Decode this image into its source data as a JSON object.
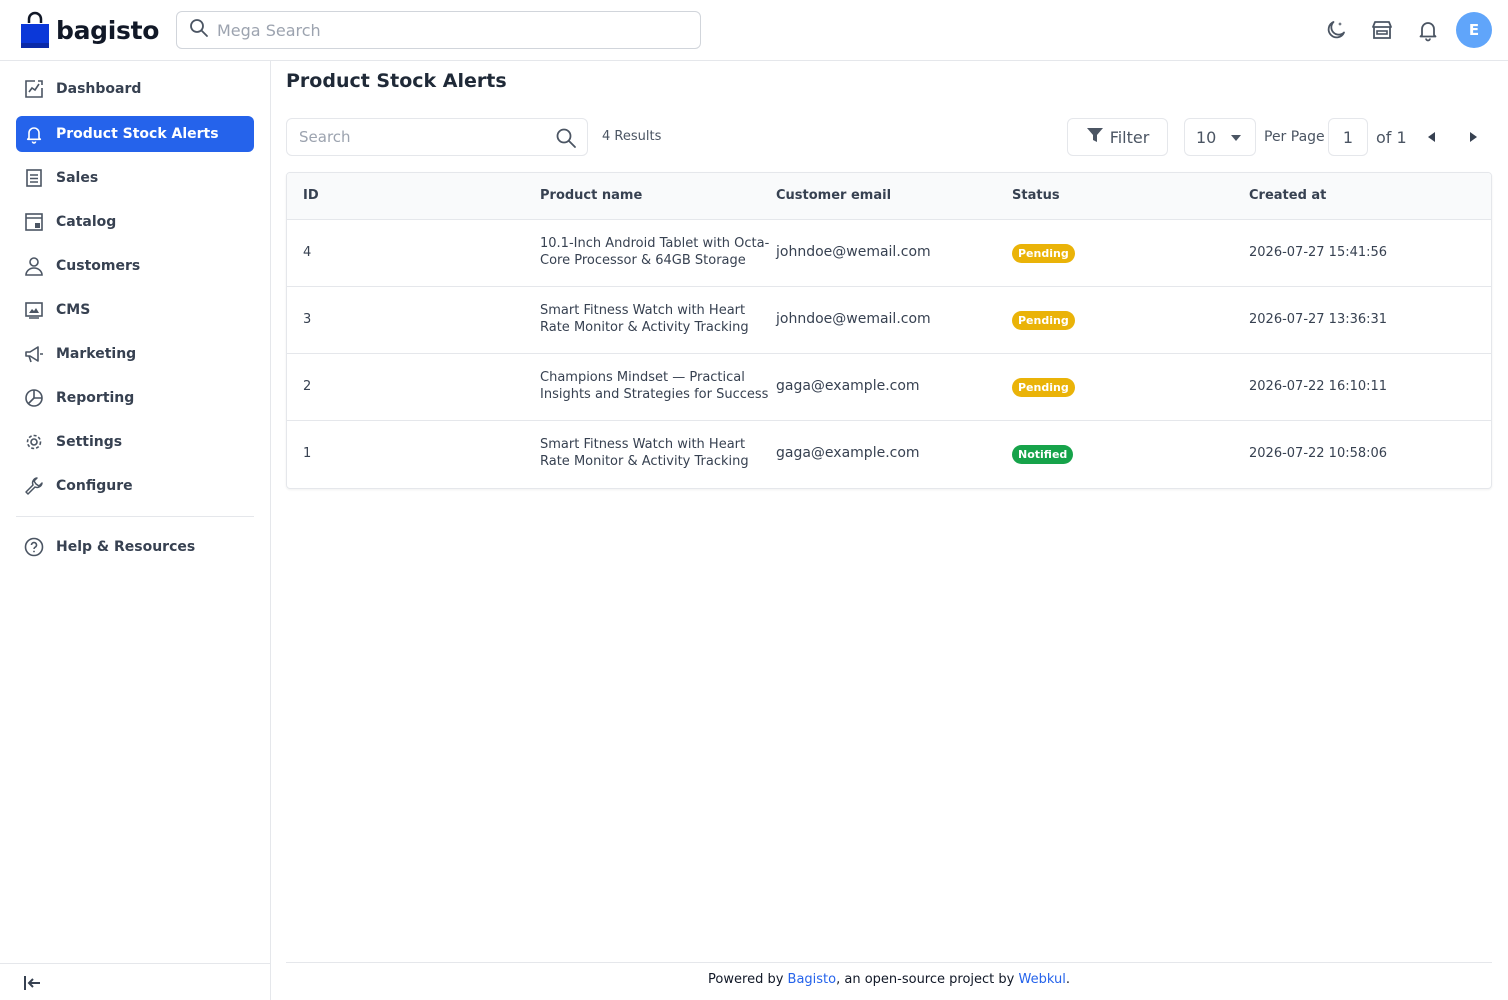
{
  "header": {
    "logo_text": "bagisto",
    "search_placeholder": "Mega Search",
    "avatar_initial": "E",
    "brand_color": "#2563eb"
  },
  "sidebar": {
    "items": [
      {
        "label": "Dashboard",
        "icon": "dashboard-icon"
      },
      {
        "label": "Product Stock Alerts",
        "icon": "bell-icon",
        "active": true
      },
      {
        "label": "Sales",
        "icon": "sales-icon"
      },
      {
        "label": "Catalog",
        "icon": "catalog-icon"
      },
      {
        "label": "Customers",
        "icon": "customer-icon"
      },
      {
        "label": "CMS",
        "icon": "cms-icon"
      },
      {
        "label": "Marketing",
        "icon": "megaphone-icon"
      },
      {
        "label": "Reporting",
        "icon": "pie-chart-icon"
      },
      {
        "label": "Settings",
        "icon": "gear-icon"
      },
      {
        "label": "Configure",
        "icon": "wrench-icon"
      }
    ],
    "help": {
      "label": "Help & Resources",
      "icon": "help-circle-icon"
    }
  },
  "main": {
    "title": "Product Stock Alerts",
    "search_placeholder": "Search",
    "results": "4 Results",
    "filter_label": "Filter",
    "per_page_value": "10",
    "per_page_label": "Per Page",
    "page_current": "1",
    "page_of": "of 1"
  },
  "table": {
    "columns": [
      "ID",
      "Product name",
      "Customer email",
      "Status",
      "Created at"
    ],
    "rows": [
      {
        "id": "4",
        "product": "10.1-Inch Android Tablet with Octa-Core Processor & 64GB Storage",
        "email": "johndoe@wemail.com",
        "status": "Pending",
        "created": "2026-07-27 15:41:56"
      },
      {
        "id": "3",
        "product": "Smart Fitness Watch with Heart Rate Monitor & Activity Tracking",
        "email": "johndoe@wemail.com",
        "status": "Pending",
        "created": "2026-07-27 13:36:31"
      },
      {
        "id": "2",
        "product": "Champions Mindset — Practical Insights and Strategies for Success",
        "email": "gaga@example.com",
        "status": "Pending",
        "created": "2026-07-22 16:10:11"
      },
      {
        "id": "1",
        "product": "Smart Fitness Watch with Heart Rate Monitor & Activity Tracking",
        "email": "gaga@example.com",
        "status": "Notified",
        "created": "2026-07-22 10:58:06"
      }
    ],
    "status_colors": {
      "Pending": "#eab308",
      "Notified": "#16a34a"
    }
  },
  "footer": {
    "prefix": "Powered by ",
    "link1": "Bagisto",
    "middle": ", an open-source project by ",
    "link2": "Webkul",
    "suffix": "."
  }
}
